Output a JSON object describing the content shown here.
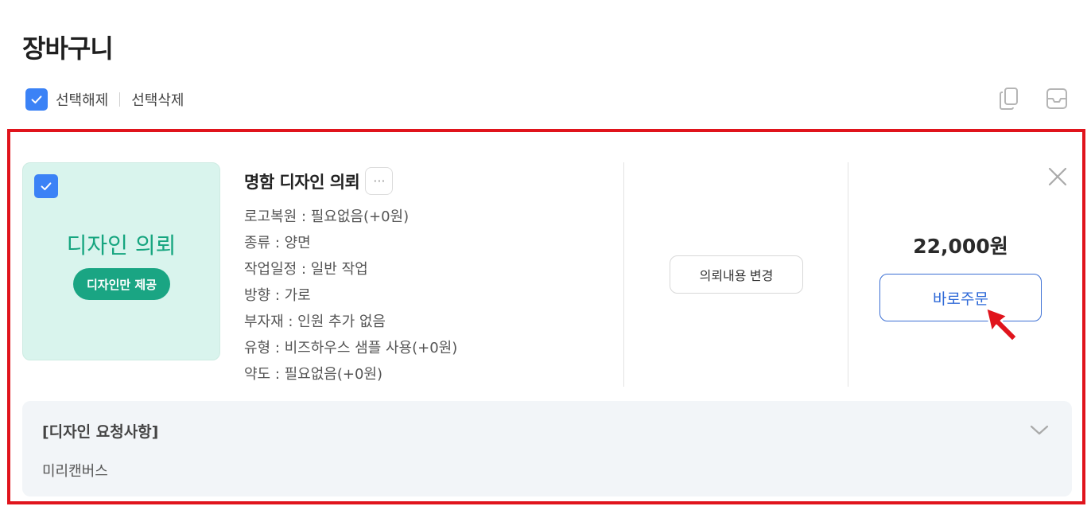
{
  "page": {
    "title": "장바구니"
  },
  "toolbar": {
    "deselect_label": "선택해제",
    "delete_label": "선택삭제"
  },
  "top_icons": [
    "copy-icon",
    "inbox-icon"
  ],
  "item": {
    "thumbnail": {
      "title": "디자인 의뢰",
      "badge": "디자인만 제공"
    },
    "product_title": "명함 디자인 의뢰",
    "more_label": "···",
    "options": [
      "로고복원 : 필요없음(+0원)",
      "종류 : 양면",
      "작업일정 : 일반 작업",
      "방향 : 가로",
      "부자재 : 인원 추가 없음",
      "유형 : 비즈하우스 샘플 사용(+0원)",
      "약도 : 필요없음(+0원)"
    ],
    "change_label": "의뢰내용 변경",
    "price": "22,000원",
    "order_label": "바로주문"
  },
  "request": {
    "title": "[디자인 요청사항]",
    "text": "미리캔버스"
  },
  "colors": {
    "accent": "#3b82f6",
    "highlight": "#e0141c",
    "green": "#1aa583",
    "thumb_bg": "#d9f4ed"
  }
}
